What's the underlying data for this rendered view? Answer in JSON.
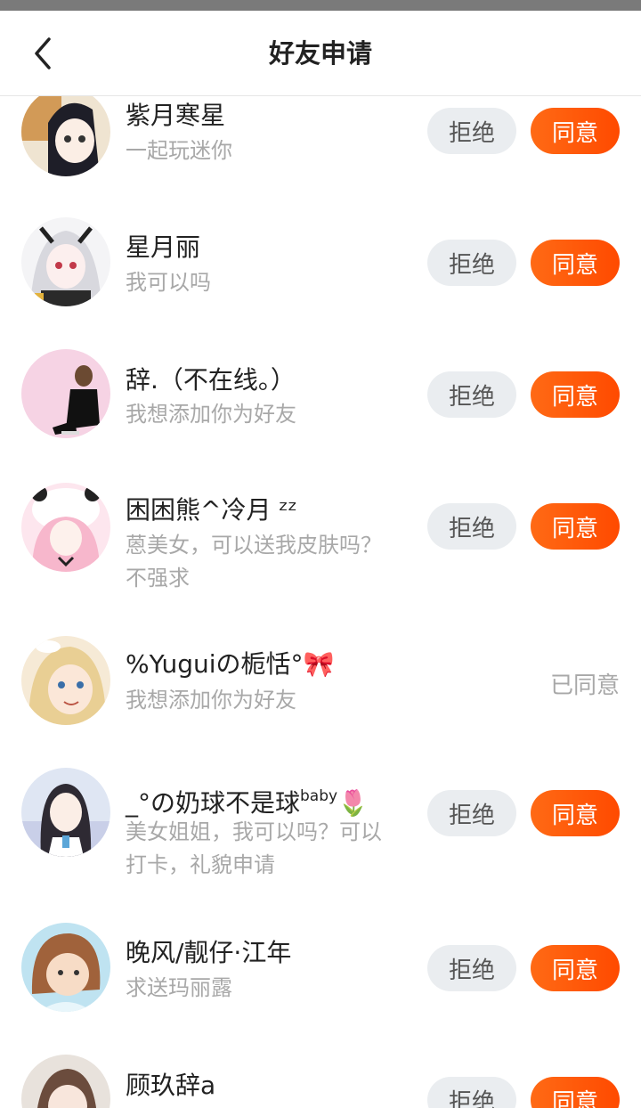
{
  "header": {
    "title": "好友申请",
    "back_icon": "chevron-left-icon"
  },
  "requests": [
    {
      "name": "紫月寒星",
      "message": "一起玩迷你",
      "status": "pending"
    },
    {
      "name": "星月丽",
      "message": "我可以吗",
      "status": "pending"
    },
    {
      "name": "辞.（不在线。）",
      "message": "我想添加你为好友",
      "status": "pending"
    },
    {
      "name": "困困熊^冷月 ᶻᶻ",
      "message": "蒽美女，可以送我皮肤吗？不强求",
      "status": "pending"
    },
    {
      "name": "%Yuguiの栀恬°🎀",
      "message": "我想添加你为好友",
      "status": "accepted"
    },
    {
      "name_main": "_°の奶球不是球",
      "name_sup": "baby",
      "name_emoji": "🌷",
      "message": "美女姐姐，我可以吗？可以打卡，礼貌申请",
      "status": "pending"
    },
    {
      "name": "晚风/靓仔·江年",
      "message": "求送玛丽露",
      "status": "pending"
    },
    {
      "name": "顾玖辞a",
      "message": "",
      "status": "pending"
    }
  ],
  "labels": {
    "reject": "拒绝",
    "accept": "同意",
    "accepted": "已同意"
  },
  "colors": {
    "accent": "#ff5a0a",
    "reject_bg": "#eaedf0",
    "muted_text": "#a8a8a8"
  }
}
